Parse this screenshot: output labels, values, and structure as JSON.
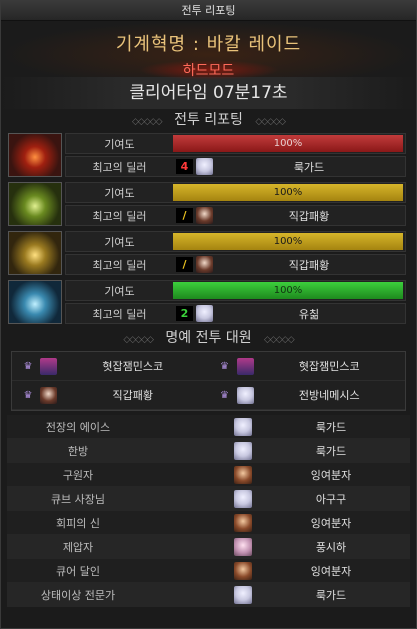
{
  "window": {
    "title": "전투 리포팅"
  },
  "raid": {
    "name": "기계혁명 : 바칼 레이드",
    "mode": "하드모드"
  },
  "clear": {
    "time_text": "클리어타임  07분17초"
  },
  "report": {
    "section_title": "전투 리포팅",
    "contribution_label": "기여도",
    "top_dealer_label": "최고의 딜러",
    "bosses": [
      {
        "icon": "red-dragon-portrait",
        "bar_color": "#b02020",
        "contribution_text": "100%",
        "contribution": 1.0,
        "rank_badge": "4",
        "rank_color": "#ff3a3a",
        "dealer": "룩가드"
      },
      {
        "icon": "green-dragon-portrait",
        "bar_color": "#c9a81e",
        "contribution_text": "100%",
        "contribution": 1.0,
        "rank_badge": "/",
        "rank_color": "#e8c020",
        "dealer": "직갑패황"
      },
      {
        "icon": "gold-dragon-portrait",
        "bar_color": "#c9a81e",
        "contribution_text": "100%",
        "contribution": 1.0,
        "rank_badge": "/",
        "rank_color": "#e8c020",
        "dealer": "직갑패황"
      },
      {
        "icon": "blue-dragon-portrait",
        "bar_color": "#2faa2f",
        "contribution_text": "100%",
        "contribution": 1.0,
        "rank_badge": "2",
        "rank_color": "#3ad03a",
        "dealer": "유칢"
      }
    ]
  },
  "honor": {
    "section_title": "명예 전투 대원",
    "members": [
      {
        "name": "혓잡잼민스코",
        "avatar": "masked"
      },
      {
        "name": "혓잡잼민스코",
        "avatar": "masked"
      },
      {
        "name": "직갑패황",
        "avatar": "dark"
      },
      {
        "name": "전방네메시스",
        "avatar": "white"
      }
    ]
  },
  "awards": [
    {
      "title": "전장의 에이스",
      "avatar": "white",
      "name": "룩가드"
    },
    {
      "title": "한방",
      "avatar": "white",
      "name": "룩가드"
    },
    {
      "title": "구원자",
      "avatar": "brown",
      "name": "잉여분자"
    },
    {
      "title": "큐브 사장님",
      "avatar": "white",
      "name": "아구구"
    },
    {
      "title": "회피의 신",
      "avatar": "brown",
      "name": "잉여분자"
    },
    {
      "title": "제압자",
      "avatar": "pink",
      "name": "풍시하"
    },
    {
      "title": "큐어 달인",
      "avatar": "brown",
      "name": "잉여분자"
    },
    {
      "title": "상태이상 전문가",
      "avatar": "white",
      "name": "룩가드"
    }
  ]
}
